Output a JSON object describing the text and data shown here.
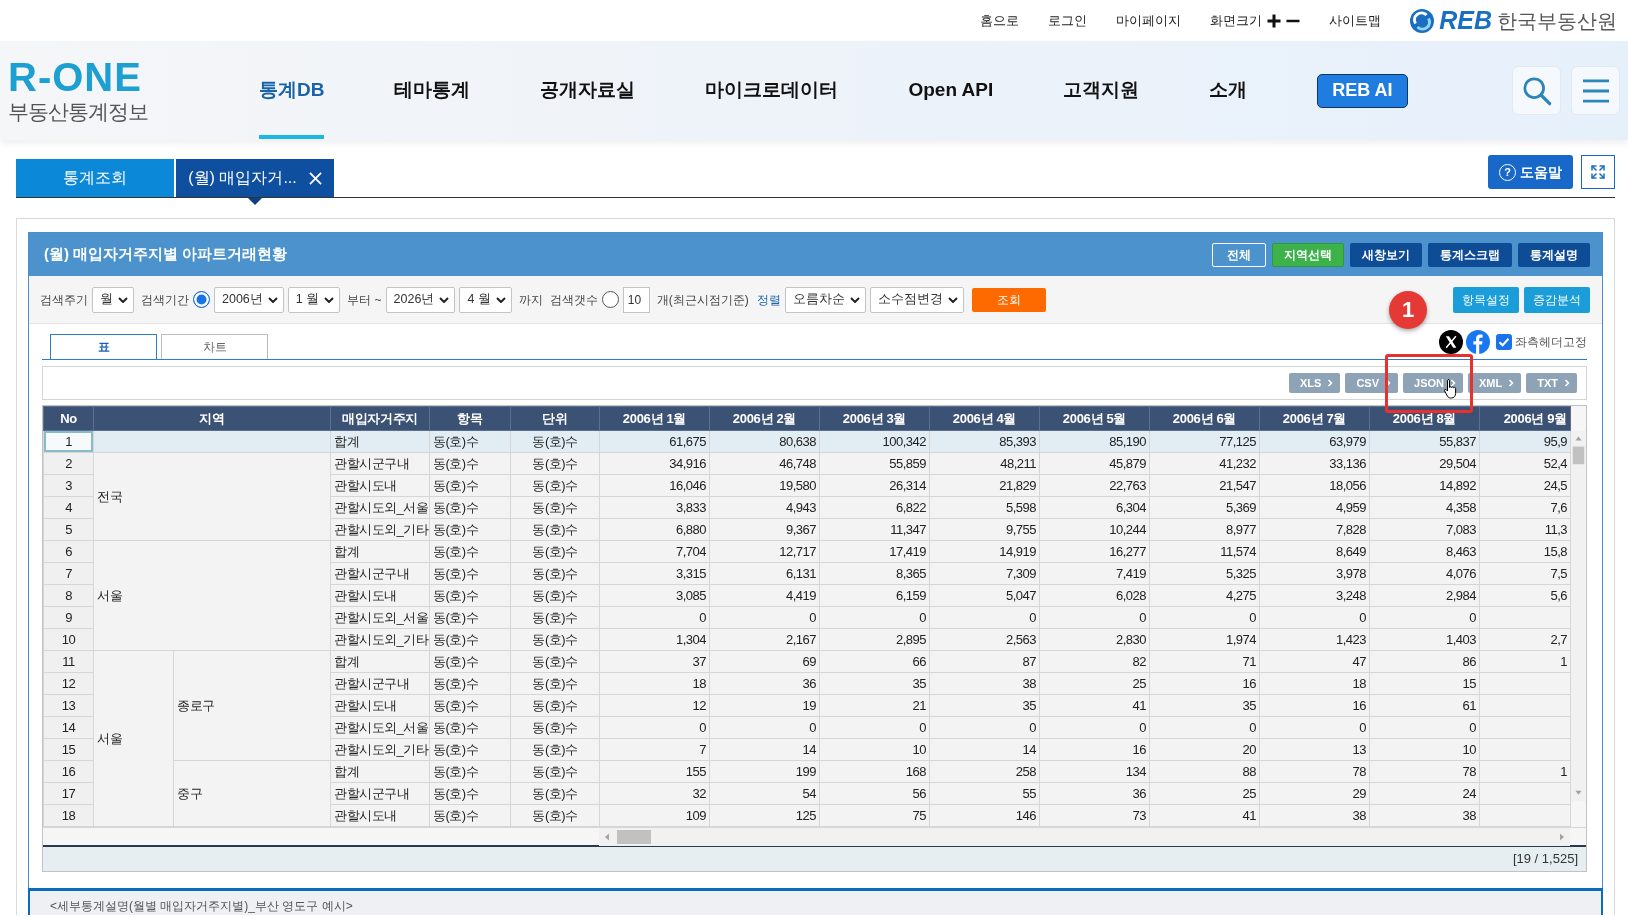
{
  "top_links": [
    {
      "label": "홈으로",
      "kind": "link"
    },
    {
      "label": "로그인",
      "kind": "link"
    },
    {
      "label": "마이페이지",
      "kind": "link"
    },
    {
      "label": "화면크기",
      "kind": "zoom"
    },
    {
      "label": "사이트맵",
      "kind": "link"
    }
  ],
  "org_logo": {
    "mark": "REB",
    "name": "한국부동산원"
  },
  "logo": {
    "mark": "R-ONE",
    "subtitle": "부동산통계정보"
  },
  "nav": [
    {
      "label": "통계DB",
      "kind": "menu",
      "selected": true
    },
    {
      "label": "테마통계",
      "kind": "menu",
      "selected": false
    },
    {
      "label": "공개자료실",
      "kind": "menu",
      "selected": false
    },
    {
      "label": "마이크로데이터",
      "kind": "menu",
      "selected": false
    },
    {
      "label": "Open API",
      "kind": "menu",
      "selected": false
    },
    {
      "label": "고객지원",
      "kind": "menu",
      "selected": false
    },
    {
      "label": "소개",
      "kind": "menu",
      "selected": false
    },
    {
      "label": "REB AI",
      "kind": "button",
      "selected": false
    }
  ],
  "doc_tabs": [
    {
      "label": "통계조회",
      "selected": false,
      "closable": false
    },
    {
      "label": "(월) 매입자거...",
      "selected": true,
      "closable": true
    }
  ],
  "help_button": {
    "icon": "?",
    "label": "도움말"
  },
  "panel": {
    "title": "(월) 매입자거주지별 아파트거래현황",
    "buttons": [
      {
        "label": "전체",
        "kind": "outline"
      },
      {
        "label": "지역선택",
        "kind": "success"
      },
      {
        "label": "새창보기",
        "kind": "dark"
      },
      {
        "label": "통계스크랩",
        "kind": "dark"
      },
      {
        "label": "통계설명",
        "kind": "dark"
      }
    ]
  },
  "search": {
    "items": [
      {
        "kind": "label",
        "text": "검색주기"
      },
      {
        "kind": "select",
        "value": "월"
      },
      {
        "kind": "label",
        "text": "검색기간"
      },
      {
        "kind": "radio",
        "checked": true
      },
      {
        "kind": "select",
        "value": "2006년"
      },
      {
        "kind": "select",
        "value": "1 월"
      },
      {
        "kind": "label",
        "text": "부터 ~"
      },
      {
        "kind": "select",
        "value": "2026년"
      },
      {
        "kind": "select",
        "value": "4 월"
      },
      {
        "kind": "label",
        "text": "까지"
      },
      {
        "kind": "label",
        "text": "검색갯수"
      },
      {
        "kind": "radio",
        "checked": false
      },
      {
        "kind": "input",
        "value": "10"
      },
      {
        "kind": "label",
        "text": "개(최근시점기준)"
      },
      {
        "kind": "link",
        "text": "정렬"
      },
      {
        "kind": "select",
        "value": "오름차순"
      },
      {
        "kind": "select",
        "value": "소수점변경"
      },
      {
        "kind": "button",
        "text": "조회"
      }
    ],
    "actions": [
      {
        "label": "항목설정"
      },
      {
        "label": "증감분석"
      }
    ]
  },
  "view_tabs": [
    {
      "label": "표",
      "selected": true
    },
    {
      "label": "차트",
      "selected": false
    }
  ],
  "pin_header": {
    "label": "좌측헤더고정",
    "checked": true
  },
  "downloads": [
    {
      "label": "XLS",
      "highlighted": false,
      "hovered": false
    },
    {
      "label": "CSV",
      "highlighted": false,
      "hovered": false
    },
    {
      "label": "JSON",
      "highlighted": true,
      "hovered": true
    },
    {
      "label": "XML",
      "highlighted": false,
      "hovered": false
    },
    {
      "label": "TXT",
      "highlighted": false,
      "hovered": false
    }
  ],
  "annotation": {
    "label": "1"
  },
  "table": {
    "columns": [
      "No",
      "지역",
      "매입자거주지",
      "항목",
      "단위",
      "2006년 1월",
      "2006년 2월",
      "2006년 3월",
      "2006년 4월",
      "2006년 5월",
      "2006년 6월",
      "2006년 7월",
      "2006년 8월",
      "2006년 9월"
    ],
    "regions": [
      {
        "rows": [
          {
            "no": "1",
            "residence": "합계",
            "item": "동(호)수",
            "unit": "동(호)수",
            "selected": true,
            "values": [
              "61,675",
              "80,638",
              "100,342",
              "85,393",
              "85,190",
              "77,125",
              "63,979",
              "55,837",
              "95,9"
            ]
          }
        ]
      },
      {
        "name": "전국",
        "rows": [
          {
            "no": "2",
            "residence": "관할시군구내",
            "item": "동(호)수",
            "unit": "동(호)수",
            "selected": false,
            "values": [
              "34,916",
              "46,748",
              "55,859",
              "48,211",
              "45,879",
              "41,232",
              "33,136",
              "29,504",
              "52,4"
            ]
          },
          {
            "no": "3",
            "residence": "관할시도내",
            "item": "동(호)수",
            "unit": "동(호)수",
            "selected": false,
            "values": [
              "16,046",
              "19,580",
              "26,314",
              "21,829",
              "22,763",
              "21,547",
              "18,056",
              "14,892",
              "24,5"
            ]
          },
          {
            "no": "4",
            "residence": "관할시도외_서울",
            "item": "동(호)수",
            "unit": "동(호)수",
            "selected": false,
            "values": [
              "3,833",
              "4,943",
              "6,822",
              "5,598",
              "6,304",
              "5,369",
              "4,959",
              "4,358",
              "7,6"
            ]
          },
          {
            "no": "5",
            "residence": "관할시도외_기타",
            "item": "동(호)수",
            "unit": "동(호)수",
            "selected": false,
            "values": [
              "6,880",
              "9,367",
              "11,347",
              "9,755",
              "10,244",
              "8,977",
              "7,828",
              "7,083",
              "11,3"
            ]
          }
        ]
      },
      {
        "name": "서울",
        "rows": [
          {
            "no": "6",
            "residence": "합계",
            "item": "동(호)수",
            "unit": "동(호)수",
            "selected": false,
            "values": [
              "7,704",
              "12,717",
              "17,419",
              "14,919",
              "16,277",
              "11,574",
              "8,649",
              "8,463",
              "15,8"
            ]
          },
          {
            "no": "7",
            "residence": "관할시군구내",
            "item": "동(호)수",
            "unit": "동(호)수",
            "selected": false,
            "values": [
              "3,315",
              "6,131",
              "8,365",
              "7,309",
              "7,419",
              "5,325",
              "3,978",
              "4,076",
              "7,5"
            ]
          },
          {
            "no": "8",
            "residence": "관할시도내",
            "item": "동(호)수",
            "unit": "동(호)수",
            "selected": false,
            "values": [
              "3,085",
              "4,419",
              "6,159",
              "5,047",
              "6,028",
              "4,275",
              "3,248",
              "2,984",
              "5,6"
            ]
          },
          {
            "no": "9",
            "residence": "관할시도외_서울",
            "item": "동(호)수",
            "unit": "동(호)수",
            "selected": false,
            "values": [
              "0",
              "0",
              "0",
              "0",
              "0",
              "0",
              "0",
              "0"
            ]
          },
          {
            "no": "10",
            "residence": "관할시도외_기타",
            "item": "동(호)수",
            "unit": "동(호)수",
            "selected": false,
            "values": [
              "1,304",
              "2,167",
              "2,895",
              "2,563",
              "2,830",
              "1,974",
              "1,423",
              "1,403",
              "2,7"
            ]
          }
        ]
      },
      {
        "name": "서울",
        "children": [
          {
            "name": "종로구",
            "rows": [
              {
                "no": "11",
                "residence": "합계",
                "item": "동(호)수",
                "unit": "동(호)수",
                "selected": false,
                "values": [
                  "37",
                  "69",
                  "66",
                  "87",
                  "82",
                  "71",
                  "47",
                  "86",
                  "1"
                ]
              },
              {
                "no": "12",
                "residence": "관할시군구내",
                "item": "동(호)수",
                "unit": "동(호)수",
                "selected": false,
                "values": [
                  "18",
                  "36",
                  "35",
                  "38",
                  "25",
                  "16",
                  "18",
                  "15"
                ]
              },
              {
                "no": "13",
                "residence": "관할시도내",
                "item": "동(호)수",
                "unit": "동(호)수",
                "selected": false,
                "values": [
                  "12",
                  "19",
                  "21",
                  "35",
                  "41",
                  "35",
                  "16",
                  "61"
                ]
              },
              {
                "no": "14",
                "residence": "관할시도외_서울",
                "item": "동(호)수",
                "unit": "동(호)수",
                "selected": false,
                "values": [
                  "0",
                  "0",
                  "0",
                  "0",
                  "0",
                  "0",
                  "0",
                  "0"
                ]
              },
              {
                "no": "15",
                "residence": "관할시도외_기타",
                "item": "동(호)수",
                "unit": "동(호)수",
                "selected": false,
                "values": [
                  "7",
                  "14",
                  "10",
                  "14",
                  "16",
                  "20",
                  "13",
                  "10"
                ]
              }
            ]
          },
          {
            "name": "중구",
            "rows": [
              {
                "no": "16",
                "residence": "합계",
                "item": "동(호)수",
                "unit": "동(호)수",
                "selected": false,
                "values": [
                  "155",
                  "199",
                  "168",
                  "258",
                  "134",
                  "88",
                  "78",
                  "78",
                  "1"
                ]
              },
              {
                "no": "17",
                "residence": "관할시군구내",
                "item": "동(호)수",
                "unit": "동(호)수",
                "selected": false,
                "values": [
                  "32",
                  "54",
                  "56",
                  "55",
                  "36",
                  "25",
                  "29",
                  "24"
                ]
              },
              {
                "no": "18",
                "residence": "관할시도내",
                "item": "동(호)수",
                "unit": "동(호)수",
                "selected": false,
                "values": [
                  "109",
                  "125",
                  "75",
                  "146",
                  "73",
                  "41",
                  "38",
                  "38"
                ]
              }
            ]
          }
        ]
      }
    ]
  },
  "footer": {
    "count": "[19 / 1,525]"
  },
  "description": "<세부통계설명(월별 매입자거주지별)_부산 영도구 예시>"
}
